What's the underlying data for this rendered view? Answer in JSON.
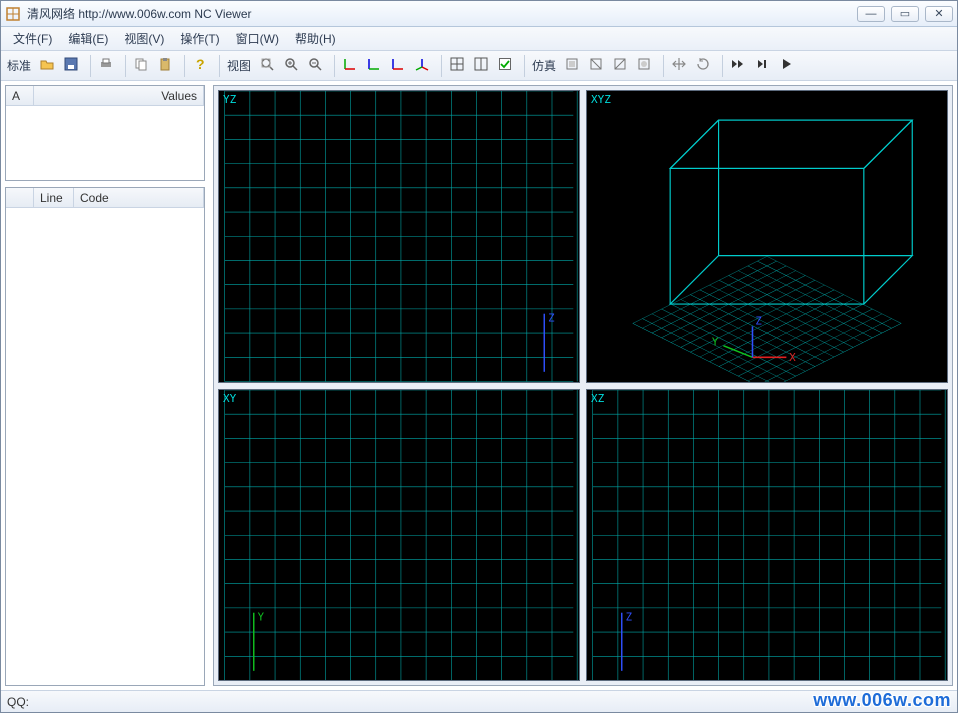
{
  "window": {
    "title": "清风网络 http://www.006w.com NC Viewer",
    "minimize": "—",
    "maximize": "▭",
    "close": "✕"
  },
  "menu": {
    "file": "文件(F)",
    "edit": "编辑(E)",
    "view": "视图(V)",
    "operate": "操作(T)",
    "window": "窗口(W)",
    "help": "帮助(H)"
  },
  "toolbar": {
    "std_label": "标准",
    "view_label": "视图",
    "sim_label": "仿真"
  },
  "left": {
    "top_col_a": "A",
    "top_col_values": "Values",
    "bot_col_line": "Line",
    "bot_col_code": "Code"
  },
  "viewports": {
    "yz": "YZ",
    "xyz": "XYZ",
    "xy": "XY",
    "xz": "XZ",
    "axis_x": "X",
    "axis_y": "Y",
    "axis_z": "Z"
  },
  "status": {
    "qq": "QQ:"
  },
  "watermark": "www.006w.com"
}
